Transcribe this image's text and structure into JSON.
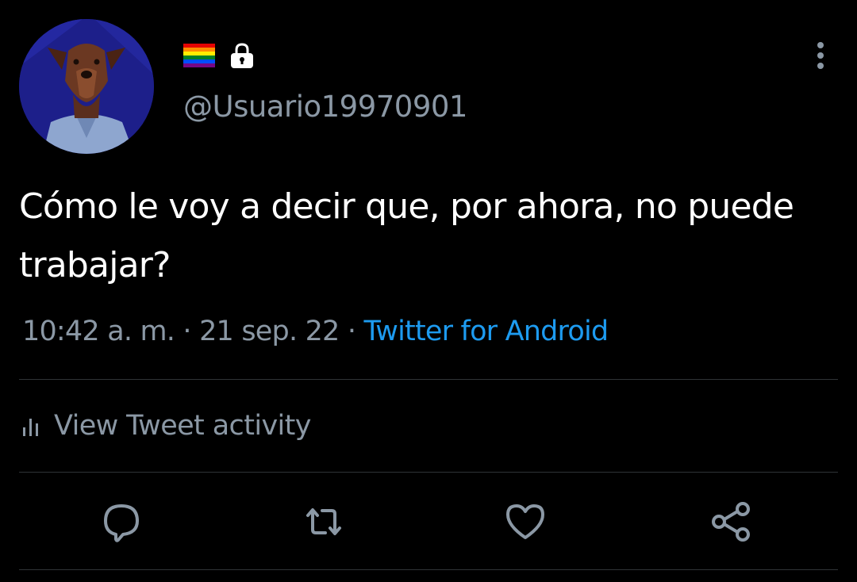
{
  "author": {
    "handle": "@Usuario19970901",
    "avatar_icon": "doberman-dog-avatar",
    "badges": [
      "rainbow-flag-icon",
      "lock-icon"
    ]
  },
  "tweet": {
    "text": "Cómo le voy a decir que, por ahora, no puede trabajar?",
    "time": "10:42 a. m.",
    "separator": " · ",
    "date": "21 sep. 22",
    "source": "Twitter for Android"
  },
  "activity": {
    "label": "View Tweet activity",
    "icon": "bar-chart-icon"
  },
  "actions": [
    "reply-icon",
    "retweet-icon",
    "like-icon",
    "share-icon"
  ],
  "colors": {
    "background": "#000000",
    "text": "#ffffff",
    "secondary_text": "#8b98a5",
    "link": "#1d9bf0",
    "divider": "#2f3336",
    "avatar_bg": "#1d1f8a"
  }
}
